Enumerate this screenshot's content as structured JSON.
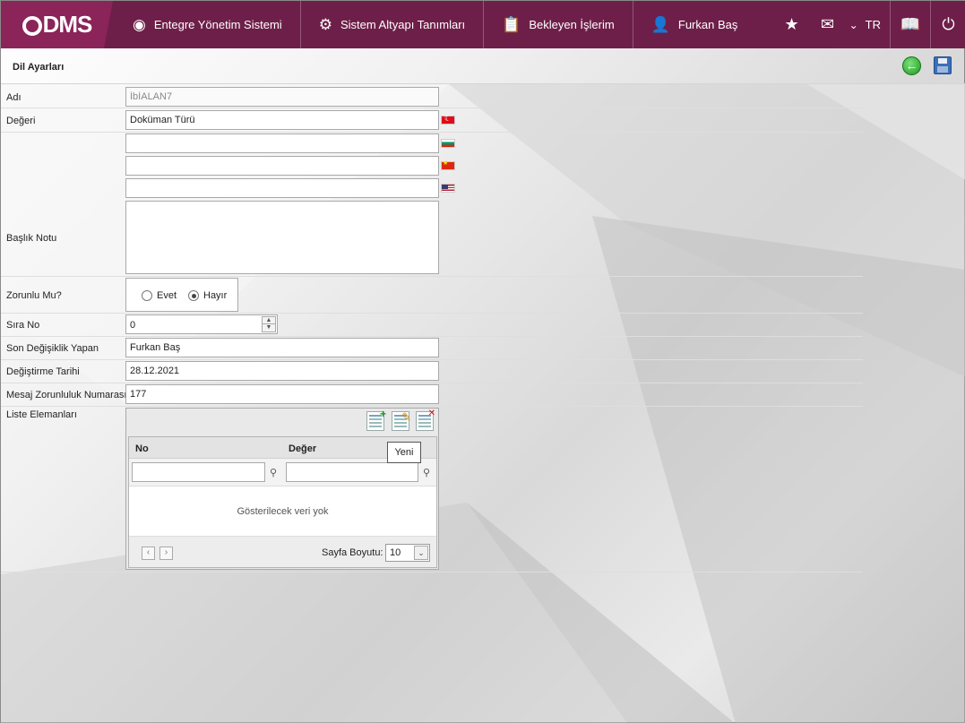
{
  "brand": {
    "logo_text": "DMS"
  },
  "nav": {
    "items": [
      {
        "label": "Entegre Yönetim Sistemi",
        "icon": "q-circle-icon"
      },
      {
        "label": "Sistem Altyapı Tanımları",
        "icon": "gear-icon"
      },
      {
        "label": "Bekleyen İşlerim",
        "icon": "clipboard-icon"
      },
      {
        "label": "Furkan Baş",
        "icon": "user-icon"
      }
    ],
    "language": "TR"
  },
  "page": {
    "title": "Dil Ayarları"
  },
  "form": {
    "name_label": "Adı",
    "name_value": "İbİALAN7",
    "value_label": "Değeri",
    "value_tr": "Doküman Türü",
    "value_bg": "",
    "value_cn": "",
    "value_us": "",
    "note_label": "Başlık Notu",
    "note_value": "",
    "required_label": "Zorunlu Mu?",
    "required_yes": "Evet",
    "required_no": "Hayır",
    "order_label": "Sıra No",
    "order_value": "0",
    "last_modifier_label": "Son Değişiklik Yapan",
    "last_modifier_value": "Furkan Baş",
    "modified_date_label": "Değiştirme Tarihi",
    "modified_date_value": "28.12.2021",
    "message_number_label": "Mesaj Zorunluluk Numarası",
    "message_number_value": "177",
    "list_label": "Liste Elemanları"
  },
  "grid": {
    "col_no": "No",
    "col_value": "Değer",
    "empty_text": "Gösterilecek veri yok",
    "page_size_label": "Sayfa Boyutu:",
    "page_size_value": "10",
    "tooltip": "Yeni"
  },
  "colors": {
    "topbar": "#6e1f49",
    "logo_bg": "#8b2459"
  }
}
